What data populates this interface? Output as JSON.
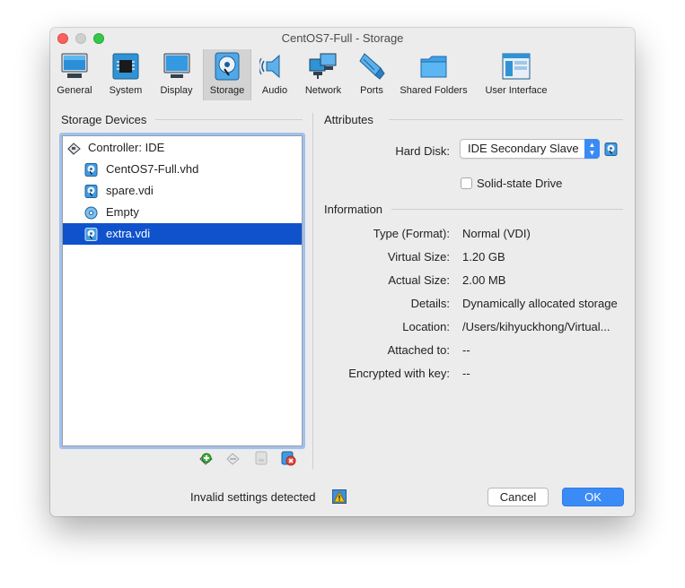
{
  "window": {
    "title": "CentOS7-Full - Storage"
  },
  "toolbar": {
    "items": [
      {
        "label": "General",
        "icon": "general-icon"
      },
      {
        "label": "System",
        "icon": "system-icon"
      },
      {
        "label": "Display",
        "icon": "display-icon"
      },
      {
        "label": "Storage",
        "icon": "storage-icon",
        "selected": true
      },
      {
        "label": "Audio",
        "icon": "audio-icon"
      },
      {
        "label": "Network",
        "icon": "network-icon"
      },
      {
        "label": "Ports",
        "icon": "ports-icon"
      },
      {
        "label": "Shared Folders",
        "icon": "shared-folders-icon"
      },
      {
        "label": "User Interface",
        "icon": "user-interface-icon"
      }
    ]
  },
  "storage_devices": {
    "title": "Storage Devices",
    "controller": {
      "label": "Controller: IDE",
      "icon": "ide-controller-icon"
    },
    "items": [
      {
        "label": "CentOS7-Full.vhd",
        "icon": "hard-disk-icon"
      },
      {
        "label": "spare.vdi",
        "icon": "hard-disk-icon"
      },
      {
        "label": "Empty",
        "icon": "optical-disk-icon"
      },
      {
        "label": "extra.vdi",
        "icon": "hard-disk-icon",
        "selected": true
      }
    ],
    "tools": [
      "add-controller-icon",
      "remove-controller-icon",
      "add-attachment-icon",
      "remove-attachment-icon"
    ]
  },
  "attributes": {
    "title": "Attributes",
    "hard_disk_label": "Hard Disk:",
    "hard_disk_value": "IDE Secondary Slave",
    "ssd_label": "Solid-state Drive",
    "ssd_checked": false
  },
  "information": {
    "title": "Information",
    "rows": [
      {
        "label": "Type (Format):",
        "value": "Normal (VDI)"
      },
      {
        "label": "Virtual Size:",
        "value": "1.20 GB"
      },
      {
        "label": "Actual Size:",
        "value": "2.00 MB"
      },
      {
        "label": "Details:",
        "value": "Dynamically allocated storage"
      },
      {
        "label": "Location:",
        "value": "/Users/kihyuckhong/Virtual..."
      },
      {
        "label": "Attached to:",
        "value": "--"
      },
      {
        "label": "Encrypted with key:",
        "value": "--"
      }
    ]
  },
  "footer": {
    "status": "Invalid settings detected",
    "cancel_label": "Cancel",
    "ok_label": "OK"
  },
  "colors": {
    "selection": "#0f52cc",
    "accent": "#3b8bf6",
    "tree_focus": "#9fc1ef"
  }
}
